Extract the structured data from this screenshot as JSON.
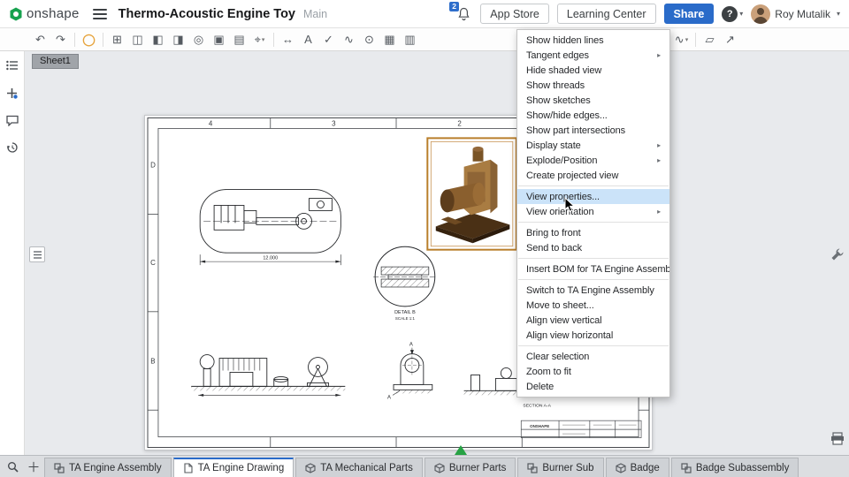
{
  "header": {
    "brand": "onshape",
    "title": "Thermo-Acoustic Engine Toy",
    "workspace": "Main",
    "notifications": "2",
    "app_store_label": "App Store",
    "learning_center_label": "Learning Center",
    "share_label": "Share",
    "help_label": "?",
    "user_name": "Roy Mutalik"
  },
  "sheet_tab": "Sheet1",
  "toolbar": {
    "items": [
      {
        "name": "undo",
        "glyph": "↶"
      },
      {
        "name": "redo",
        "glyph": "↷"
      },
      {
        "sep": true
      },
      {
        "name": "sketch",
        "glyph": "◯",
        "accent": "#e6a33c"
      },
      {
        "sep": true
      },
      {
        "name": "insert-view",
        "glyph": "⊞"
      },
      {
        "name": "projected-view",
        "glyph": "◫"
      },
      {
        "name": "auxiliary-view",
        "glyph": "◧"
      },
      {
        "name": "section-view",
        "glyph": "◨"
      },
      {
        "name": "detail-view",
        "glyph": "◎"
      },
      {
        "name": "crop-view",
        "glyph": "▣"
      },
      {
        "name": "break-view",
        "glyph": "▤"
      },
      {
        "name": "centermark",
        "glyph": "⌖",
        "caret": true
      },
      {
        "sep": true
      },
      {
        "name": "dimension",
        "glyph": "↔"
      },
      {
        "name": "note",
        "glyph": "A"
      },
      {
        "name": "surface-finish",
        "glyph": "✓"
      },
      {
        "name": "weld-symbol",
        "glyph": "∿"
      },
      {
        "name": "balloon",
        "glyph": "⊙"
      },
      {
        "name": "table",
        "glyph": "▦"
      },
      {
        "name": "hole-table",
        "glyph": "▥"
      },
      {
        "name": "v-symbol",
        "glyph": "∨",
        "caret": true,
        "gap": 238
      },
      {
        "name": "line-tool",
        "glyph": "╱"
      },
      {
        "name": "spline-tool",
        "glyph": "∿",
        "caret": true
      },
      {
        "sep": true
      },
      {
        "name": "sheet-settings",
        "glyph": "▱"
      },
      {
        "name": "export",
        "glyph": "↗"
      }
    ]
  },
  "context_menu": {
    "items": [
      {
        "label": "Show hidden lines"
      },
      {
        "label": "Tangent edges",
        "submenu": true
      },
      {
        "label": "Hide shaded view"
      },
      {
        "label": "Show threads"
      },
      {
        "label": "Show sketches"
      },
      {
        "label": "Show/hide edges..."
      },
      {
        "label": "Show part intersections"
      },
      {
        "label": "Display state",
        "submenu": true
      },
      {
        "label": "Explode/Position",
        "submenu": true
      },
      {
        "label": "Create projected view"
      },
      {
        "divider": true
      },
      {
        "label": "View properties...",
        "highlighted": true
      },
      {
        "label": "View orientation",
        "submenu": true
      },
      {
        "divider": true
      },
      {
        "label": "Bring to front"
      },
      {
        "label": "Send to back"
      },
      {
        "divider": true
      },
      {
        "label": "Insert BOM for TA Engine Assembly ..."
      },
      {
        "divider": true
      },
      {
        "label": "Switch to TA Engine Assembly"
      },
      {
        "label": "Move to sheet..."
      },
      {
        "label": "Align view vertical"
      },
      {
        "label": "Align view horizontal"
      },
      {
        "divider": true
      },
      {
        "label": "Clear selection"
      },
      {
        "label": "Zoom to fit"
      },
      {
        "label": "Delete"
      }
    ]
  },
  "tabs": {
    "items": [
      {
        "label": "TA Engine Assembly",
        "kind": "assembly",
        "active": false
      },
      {
        "label": "TA Engine Drawing",
        "kind": "drawing",
        "active": true
      },
      {
        "label": "TA Mechanical Parts",
        "kind": "parts",
        "active": false
      },
      {
        "label": "Burner Parts",
        "kind": "parts",
        "active": false
      },
      {
        "label": "Burner Sub",
        "kind": "assembly",
        "active": false
      },
      {
        "label": "Badge",
        "kind": "parts",
        "active": false
      },
      {
        "label": "Badge Subassembly",
        "kind": "assembly",
        "active": false
      }
    ]
  },
  "drawing": {
    "zones_top": [
      "4",
      "3",
      "2"
    ],
    "zones_left": [
      "D",
      "C",
      "B"
    ],
    "plan_dim": "12.000",
    "detail_title": "DETAIL B",
    "detail_scale": "SCALE 1:1",
    "section_title": "SECTION A-A",
    "section_mark": "A",
    "titleblock_brand": "ONSHAPE"
  },
  "colors": {
    "accent_blue": "#2a6bc9",
    "brand_green": "#17a24f",
    "selection_orange": "#b97e2b",
    "menu_highlight": "#cbe3f9",
    "indicator_green": "#27a244"
  }
}
